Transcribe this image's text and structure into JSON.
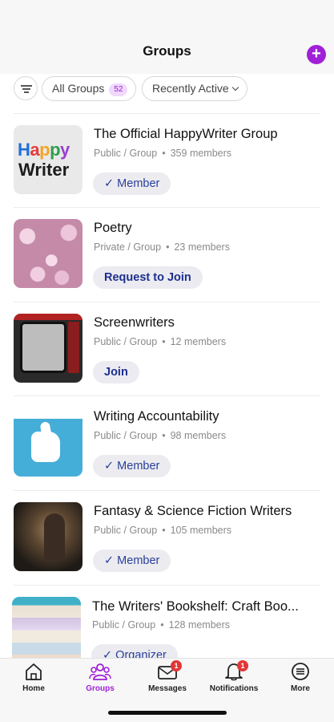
{
  "header": {
    "title": "Groups",
    "add_icon": "plus-icon",
    "accent": "#a020d8"
  },
  "filters": {
    "filter_icon": "filter-icon",
    "all_groups_label": "All Groups",
    "all_groups_count": "52",
    "sort_label": "Recently Active"
  },
  "groups": [
    {
      "name": "The Official HappyWriter Group",
      "privacy": "Public / Group",
      "members": "359 members",
      "button": "✓ Member",
      "logo_line1": "Happy",
      "logo_line2": "Writer"
    },
    {
      "name": "Poetry",
      "privacy": "Private / Group",
      "members": "23 members",
      "button": "Request to Join"
    },
    {
      "name": "Screenwriters",
      "privacy": "Public / Group",
      "members": "12 members",
      "button": "Join"
    },
    {
      "name": "Writing Accountability",
      "privacy": "Public / Group",
      "members": "98 members",
      "button": "✓ Member"
    },
    {
      "name": "Fantasy & Science Fiction Writers",
      "privacy": "Public / Group",
      "members": "105 members",
      "button": "✓ Member"
    },
    {
      "name": "The Writers' Bookshelf: Craft Boo...",
      "privacy": "Public / Group",
      "members": "128 members",
      "button": "✓ Organizer"
    }
  ],
  "nav": {
    "home": {
      "label": "Home",
      "icon": "home-icon"
    },
    "groups": {
      "label": "Groups",
      "icon": "groups-icon"
    },
    "messages": {
      "label": "Messages",
      "icon": "mail-icon",
      "badge": "1"
    },
    "notifications": {
      "label": "Notifications",
      "icon": "bell-icon",
      "badge": "1"
    },
    "more": {
      "label": "More",
      "icon": "more-icon"
    }
  }
}
